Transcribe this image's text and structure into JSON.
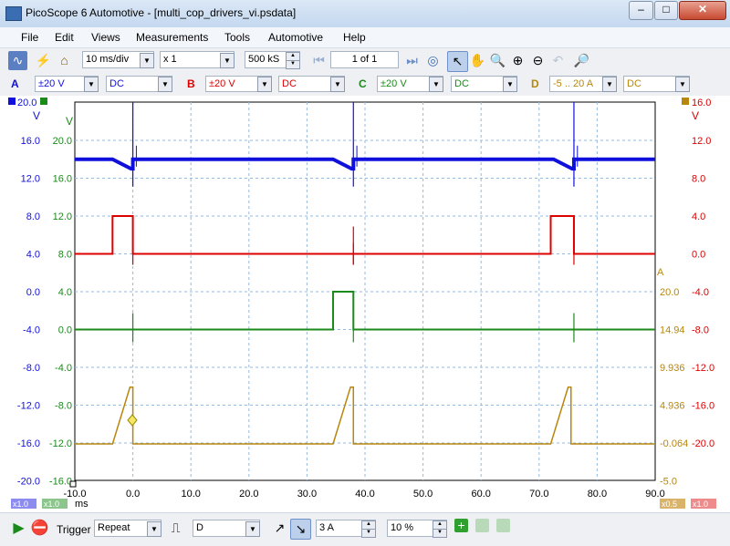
{
  "window": {
    "title": "PicoScope 6 Automotive - [multi_cop_drivers_vi.psdata]",
    "min": "–",
    "max": "□",
    "close": "✕"
  },
  "menu": [
    "File",
    "Edit",
    "Views",
    "Measurements",
    "Tools",
    "Automotive",
    "Help"
  ],
  "toolbar": {
    "timebase": "10 ms/div",
    "zoom": "x 1",
    "samples": "500 kS",
    "page": "1 of 1"
  },
  "channels": [
    {
      "id": "A",
      "range": "±20 V",
      "coupling": "DC",
      "color": "#1010dd"
    },
    {
      "id": "B",
      "range": "±20 V",
      "coupling": "DC",
      "color": "#dd0000"
    },
    {
      "id": "C",
      "range": "±20 V",
      "coupling": "DC",
      "color": "#1a8a1a"
    },
    {
      "id": "D",
      "range": "-5 .. 20 A",
      "coupling": "DC",
      "color": "#b8860b"
    }
  ],
  "axes": {
    "x_ticks": [
      "-10.0",
      "0.0",
      "10.0",
      "20.0",
      "30.0",
      "40.0",
      "50.0",
      "60.0",
      "70.0",
      "80.0",
      "90.0"
    ],
    "x_unit": "ms",
    "a_ticks": [
      "16.0",
      "12.0",
      "8.0",
      "4.0",
      "0.0",
      "-4.0",
      "-8.0",
      "-12.0",
      "-16.0",
      "-20.0"
    ],
    "a_top": "20.0",
    "a_unit": "V",
    "c_ticks": [
      "20.0",
      "16.0",
      "12.0",
      "8.0",
      "4.0",
      "0.0",
      "-4.0",
      "-8.0",
      "-12.0",
      "-16.0"
    ],
    "c_unit": "V",
    "b_ticks": [
      "12.0",
      "8.0",
      "4.0",
      "0.0",
      "-4.0",
      "-8.0",
      "-12.0",
      "-16.0",
      "-20.0"
    ],
    "b_top": "16.0",
    "b_unit": "V",
    "d_ticks": [
      "20.0",
      "14.94",
      "9.936",
      "4.936",
      "-0.064",
      "-5.0"
    ],
    "d_unit": "A",
    "scale_a": "x1.0",
    "scale_c": "x1.0",
    "scale_d": "x0.5",
    "scale_b": "x1.0"
  },
  "chart_data": {
    "type": "line",
    "x": {
      "min": -10,
      "max": 90,
      "unit": "ms"
    },
    "series": [
      {
        "name": "A",
        "color": "#1010dd",
        "unit": "V",
        "baseline": 14,
        "events_ms": [
          0,
          38,
          76
        ]
      },
      {
        "name": "B",
        "color": "#dd0000",
        "unit": "V",
        "baseline": 0,
        "pulse_high": 4,
        "pulses_ms": [
          [
            -3.5,
            0
          ],
          [
            72,
            76
          ]
        ]
      },
      {
        "name": "C",
        "color": "#1a8a1a",
        "unit": "V",
        "baseline": 0,
        "pulse_high": 4,
        "pulses_ms": [
          [
            34.5,
            38
          ]
        ]
      },
      {
        "name": "D",
        "color": "#b8860b",
        "unit": "A",
        "baseline": 0,
        "peak": 7.5,
        "ramps_ms": [
          [
            -3.5,
            -0.5
          ],
          [
            34.5,
            37.5
          ],
          [
            72,
            75
          ]
        ]
      }
    ],
    "grid": true
  },
  "status": {
    "trigger_label": "Trigger",
    "trigger_mode": "Repeat",
    "trigger_source": "D",
    "threshold": "3 A",
    "pretrigger": "10 %"
  }
}
